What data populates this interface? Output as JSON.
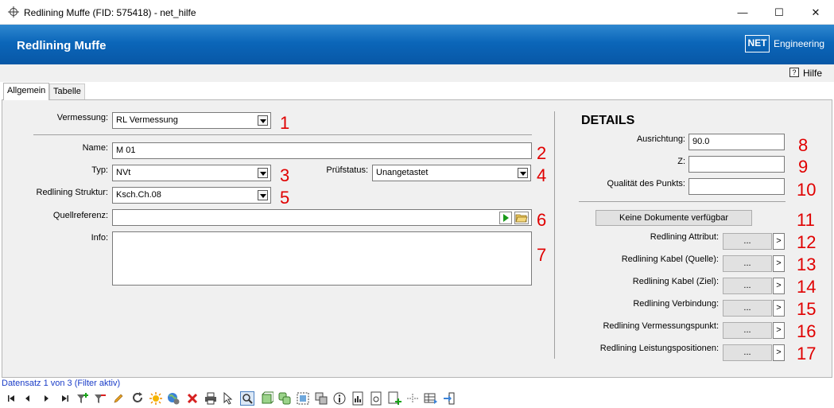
{
  "window": {
    "title": "Redlining Muffe (FID: 575418) - net_hilfe",
    "minimize": "—",
    "maximize": "☐",
    "close": "✕"
  },
  "banner": {
    "title": "Redlining Muffe",
    "logo_net": "NET",
    "logo_text": "Engineering"
  },
  "help": {
    "label": "Hilfe",
    "icon": "question-icon"
  },
  "tabs": [
    {
      "label": "Allgemein",
      "active": true
    },
    {
      "label": "Tabelle",
      "active": false
    }
  ],
  "left": {
    "vermessung": {
      "label": "Vermessung:",
      "value": "RL Vermessung",
      "num": "1"
    },
    "name": {
      "label": "Name:",
      "value": "M 01",
      "num": "2"
    },
    "typ": {
      "label": "Typ:",
      "value": "NVt",
      "num": "3"
    },
    "pruefstatus": {
      "label": "Prüfstatus:",
      "value": "Unangetastet",
      "num": "4"
    },
    "struktur": {
      "label": "Redlining Struktur:",
      "value": "Ksch.Ch.08",
      "num": "5"
    },
    "quellreferenz": {
      "label": "Quellreferenz:",
      "value": "",
      "num": "6"
    },
    "info": {
      "label": "Info:",
      "value": "",
      "num": "7"
    }
  },
  "details": {
    "heading": "DETAILS",
    "ausrichtung": {
      "label": "Ausrichtung:",
      "value": "90.0",
      "num": "8"
    },
    "z": {
      "label": "Z:",
      "value": "",
      "num": "9"
    },
    "qualitaet": {
      "label": "Qualität des Punkts:",
      "value": "",
      "num": "10"
    },
    "documents_button": {
      "label": "Keine Dokumente verfügbar",
      "num": "11"
    },
    "relations": [
      {
        "label": "Redlining Attribut:",
        "button": "...",
        "arrow": ">",
        "num": "12"
      },
      {
        "label": "Redlining Kabel (Quelle):",
        "button": "...",
        "arrow": ">",
        "num": "13"
      },
      {
        "label": "Redlining Kabel (Ziel):",
        "button": "...",
        "arrow": ">",
        "num": "14"
      },
      {
        "label": "Redlining Verbindung:",
        "button": "...",
        "arrow": ">",
        "num": "15"
      },
      {
        "label": "Redlining Vermessungspunkt:",
        "button": "...",
        "arrow": ">",
        "num": "16"
      },
      {
        "label": "Redlining Leistungspositionen:",
        "button": "...",
        "arrow": ">",
        "num": "17"
      }
    ]
  },
  "status": {
    "text": "Datensatz 1 von 3 (Filter aktiv)"
  },
  "toolbar": [
    "first-record-icon",
    "previous-record-icon",
    "next-record-icon",
    "last-record-icon",
    "add-filter-icon",
    "remove-filter-icon",
    "edit-icon",
    "refresh-icon",
    "highlight-icon",
    "web-map-icon",
    "delete-icon",
    "print-icon",
    "select-icon",
    "zoom-icon",
    "shape-icon",
    "copy-shape-icon",
    "frame-icon",
    "layers-icon",
    "info-icon",
    "report-icon",
    "document-icon",
    "add-document-icon",
    "connect-icon",
    "table-edit-icon",
    "exit-icon"
  ],
  "colors": {
    "banner": "#0b66b9",
    "numbers": "#e00000",
    "status": "#1a3cc8"
  }
}
